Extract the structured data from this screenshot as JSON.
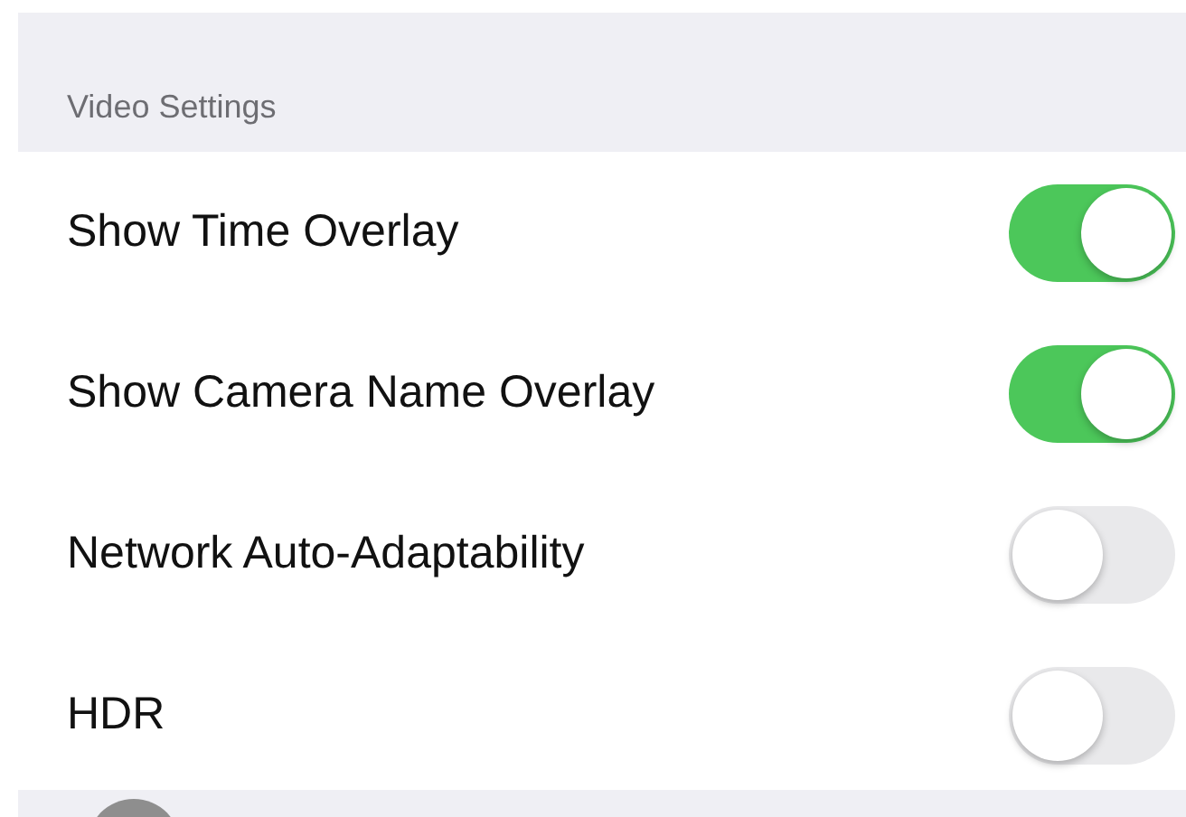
{
  "section": {
    "title": "Video Settings"
  },
  "settings": [
    {
      "label": "Show Time Overlay",
      "on": true
    },
    {
      "label": "Show Camera Name Overlay",
      "on": true
    },
    {
      "label": "Network Auto-Adaptability",
      "on": false
    },
    {
      "label": "HDR",
      "on": false
    }
  ]
}
